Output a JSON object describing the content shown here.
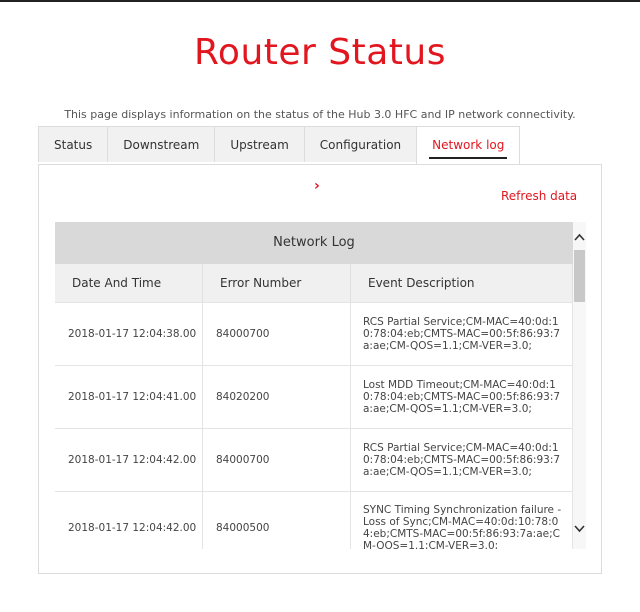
{
  "header": {
    "title": "Router Status",
    "subtitle": "This page displays information on the status of the Hub 3.0 HFC and IP network connectivity."
  },
  "tabs": [
    {
      "label": "Status"
    },
    {
      "label": "Downstream"
    },
    {
      "label": "Upstream"
    },
    {
      "label": "Configuration"
    },
    {
      "label": "Network log",
      "active": true
    }
  ],
  "panel": {
    "refresh_label": "Refresh data",
    "chevron": "›"
  },
  "network_log": {
    "title": "Network Log",
    "columns": [
      "Date And Time",
      "Error Number",
      "Event Description"
    ],
    "rows": [
      {
        "datetime": "2018-01-17 12:04:38.00",
        "error": "84000700",
        "description": "RCS Partial Service;CM-MAC=40:0d:10:78:04:eb;CMTS-MAC=00:5f:86:93:7a:ae;CM-QOS=1.1;CM-VER=3.0;"
      },
      {
        "datetime": "2018-01-17 12:04:41.00",
        "error": "84020200",
        "description": "Lost MDD Timeout;CM-MAC=40:0d:10:78:04:eb;CMTS-MAC=00:5f:86:93:7a:ae;CM-QOS=1.1;CM-VER=3.0;"
      },
      {
        "datetime": "2018-01-17 12:04:42.00",
        "error": "84000700",
        "description": "RCS Partial Service;CM-MAC=40:0d:10:78:04:eb;CMTS-MAC=00:5f:86:93:7a:ae;CM-QOS=1.1;CM-VER=3.0;"
      },
      {
        "datetime": "2018-01-17 12:04:42.00",
        "error": "84000500",
        "description": "SYNC Timing Synchronization failure - Loss of Sync;CM-MAC=40:0d:10:78:04:eb;CMTS-MAC=00:5f:86:93:7a:ae;CM-QOS=1.1;CM-VER=3.0;"
      }
    ]
  },
  "scrollbar": {
    "up_icon": "chevron-up-icon",
    "down_icon": "chevron-down-icon"
  },
  "colors": {
    "accent": "#e2161f",
    "header_bg": "#d9d9d9"
  }
}
